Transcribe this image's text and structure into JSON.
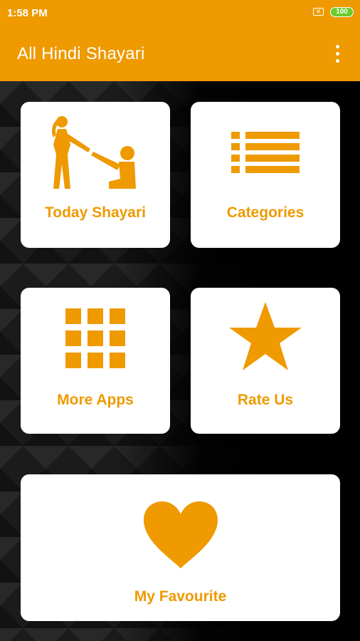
{
  "status_bar": {
    "time": "1:58 PM",
    "sim_symbol": "✕",
    "battery": "100"
  },
  "app_bar": {
    "title": "All Hindi Shayari",
    "menu_icon": "more-vert-icon"
  },
  "tiles": [
    {
      "label": "Today Shayari",
      "icon": "couple-proposal-icon"
    },
    {
      "label": "Categories",
      "icon": "list-icon"
    },
    {
      "label": "More Apps",
      "icon": "grid-icon"
    },
    {
      "label": "Rate Us",
      "icon": "star-icon"
    },
    {
      "label": "My Favourite",
      "icon": "heart-icon"
    }
  ],
  "colors": {
    "accent": "#EE9A00",
    "tile_bg": "#FFFFFF",
    "battery": "#6BCB2E"
  }
}
